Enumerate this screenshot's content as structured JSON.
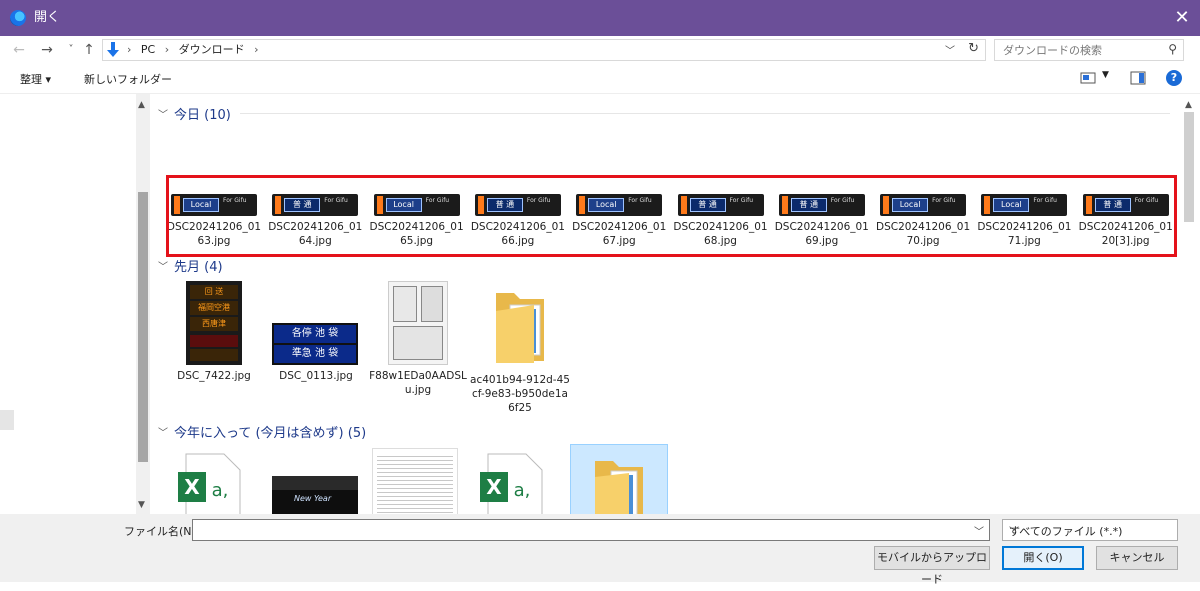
{
  "window": {
    "title": "開く",
    "close": "✕"
  },
  "nav": {
    "back": "←",
    "forward": "→",
    "recent": "˅",
    "up": "↑",
    "breadcrumb": [
      "PC",
      "ダウンロード"
    ],
    "search_placeholder": "ダウンロードの検索"
  },
  "toolbar": {
    "organize": "整理 ▾",
    "new_folder": "新しいフォルダー",
    "help": "?"
  },
  "groups": [
    {
      "label": "今日 (10)",
      "files": [
        {
          "name": "DSC20241206_0163.jpg",
          "kind": "local"
        },
        {
          "name": "DSC20241206_0164.jpg",
          "kind": "futsu"
        },
        {
          "name": "DSC20241206_0165.jpg",
          "kind": "local"
        },
        {
          "name": "DSC20241206_0166.jpg",
          "kind": "futsu"
        },
        {
          "name": "DSC20241206_0167.jpg",
          "kind": "local"
        },
        {
          "name": "DSC20241206_0168.jpg",
          "kind": "futsu"
        },
        {
          "name": "DSC20241206_0169.jpg",
          "kind": "futsu"
        },
        {
          "name": "DSC20241206_0170.jpg",
          "kind": "local"
        },
        {
          "name": "DSC20241206_0171.jpg",
          "kind": "local"
        },
        {
          "name": "DSC20241206_0120[3].jpg",
          "kind": "futsu"
        }
      ]
    },
    {
      "label": "先月 (4)",
      "files": [
        {
          "name": "DSC_7422.jpg"
        },
        {
          "name": "DSC_0113.jpg"
        },
        {
          "name": "F88w1EDa0AADSLu.jpg"
        },
        {
          "name": "ac401b94-912d-45cf-9e83-b950de1a6f25"
        }
      ]
    },
    {
      "label": "今年に入って (今月は含めず) (5)",
      "files": []
    }
  ],
  "sign_text": {
    "local": "Local",
    "futsu": "普 通",
    "for": "For Gifu"
  },
  "thumb_text": {
    "sign1": [
      "回 送",
      "福岡空港",
      "西唐津"
    ],
    "sign2": [
      "各停 池 袋",
      "準急 池 袋"
    ],
    "newyear": "New Year"
  },
  "bottom": {
    "filename_label": "ファイル名(N):",
    "filename_value": "",
    "filetype": "すべてのファイル (*.*)",
    "upload": "モバイルからアップロード",
    "open": "開く(O)",
    "cancel": "キャンセル"
  }
}
